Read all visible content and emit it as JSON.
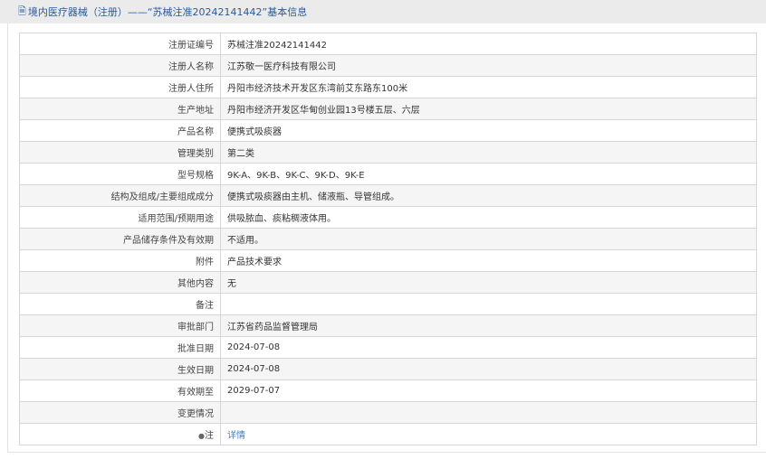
{
  "header": {
    "icon": "document-icon",
    "title": "境内医疗器械（注册）——“苏械注准20242141442”基本信息"
  },
  "rows": [
    {
      "label": "注册证编号",
      "value": "苏械注准20242141442"
    },
    {
      "label": "注册人名称",
      "value": "江苏敬一医疗科技有限公司"
    },
    {
      "label": "注册人住所",
      "value": "丹阳市经济技术开发区东湾前艾东路东100米"
    },
    {
      "label": "生产地址",
      "value": "丹阳市经济开发区华甸创业园13号楼五层、六层"
    },
    {
      "label": "产品名称",
      "value": "便携式吸痰器"
    },
    {
      "label": "管理类别",
      "value": "第二类"
    },
    {
      "label": "型号规格",
      "value": "9K-A、9K-B、9K-C、9K-D、9K-E"
    },
    {
      "label": "结构及组成/主要组成成分",
      "value": "便携式吸痰器由主机、储液瓶、导管组成。"
    },
    {
      "label": "适用范围/预期用途",
      "value": "供吸脓血、痰粘稠液体用。"
    },
    {
      "label": "产品储存条件及有效期",
      "value": "不适用。"
    },
    {
      "label": "附件",
      "value": "产品技术要求"
    },
    {
      "label": "其他内容",
      "value": "无"
    },
    {
      "label": "备注",
      "value": ""
    },
    {
      "label": "审批部门",
      "value": "江苏省药品监督管理局"
    },
    {
      "label": "批准日期",
      "value": "2024-07-08"
    },
    {
      "label": "生效日期",
      "value": "2024-07-08"
    },
    {
      "label": "有效期至",
      "value": "2029-07-07"
    },
    {
      "label": "变更情况",
      "value": ""
    },
    {
      "label": "注",
      "value": "详情"
    }
  ]
}
